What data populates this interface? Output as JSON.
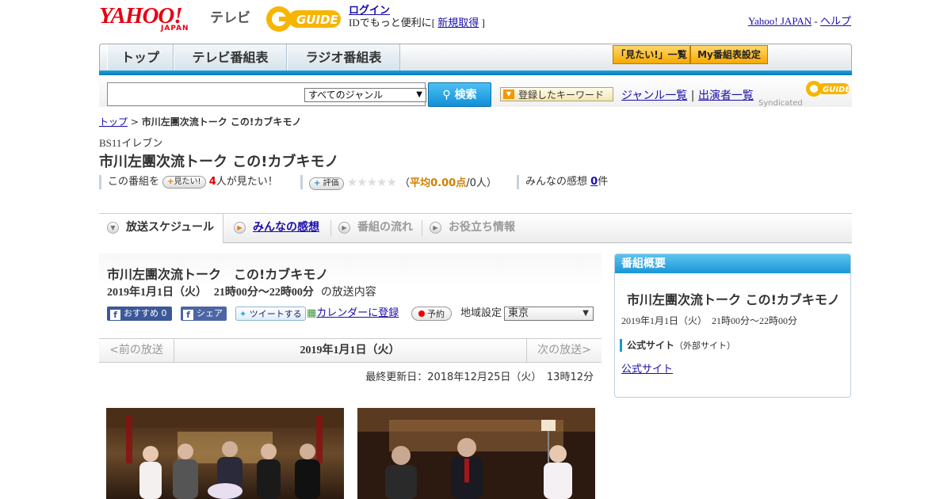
{
  "header": {
    "yahoo_logo": "YAHOO!",
    "yahoo_sub": "JAPAN",
    "tv_label": "テレビ",
    "gguide_logo": "G GUIDE",
    "login": "ログイン",
    "login_msg": "IDでもっと便利に[",
    "register": "新規取得",
    "login_msg_end": "]",
    "yahoo_japan_link": "Yahoo! JAPAN",
    "dash": "-",
    "help_link": "ヘルプ"
  },
  "nav": {
    "tabs": [
      "トップ",
      "テレビ番組表",
      "ラジオ番組表"
    ],
    "mitai_btn": "「見たい!」一覧",
    "my_btn": "My番組表設定"
  },
  "search": {
    "placeholder": "",
    "genre": "すべてのジャンル",
    "button": "検索",
    "keyword_btn": "登録したキーワード",
    "genre_list": "ジャンル一覧",
    "sep": "|",
    "performers": "出演者一覧",
    "syndicated": "Syndicated"
  },
  "breadcrumb": {
    "top": "トップ",
    "sep": ">",
    "current": "市川左團次流トーク この!カブキモノ"
  },
  "program": {
    "channel": "BS11イレブン",
    "title": "市川左團次流トーク この!カブキモノ",
    "watch_prefix": "この番組を",
    "mitai_pill": "見たい!",
    "watch_count": "4",
    "watch_suffix": "人が見たい！",
    "rate_pill": "評価",
    "stars": "★★★★★",
    "avg_open": "（",
    "avg": "平均0.00点",
    "avg_rest": "/0人）",
    "comments_label": "みんなの感想",
    "comments_count": "0",
    "comments_suffix": "件"
  },
  "tabs": [
    {
      "label": "放送スケジュール"
    },
    {
      "label": "みんなの感想"
    },
    {
      "label": "番組の流れ"
    },
    {
      "label": "お役立ち情報"
    }
  ],
  "broadcast": {
    "title": "市川左團次流トーク　この!カブキモノ",
    "date": "2019年1月1日（火）",
    "time": "21時00分～22時00分",
    "suffix": "の放送内容",
    "recommend": "おすすめ",
    "recommend_count": "0",
    "share": "シェア",
    "tweet": "ツイートする",
    "calendar": "カレンダーに登録",
    "reserve": "予約",
    "region_label": "地域設定",
    "region": "東京",
    "prev": "<前の放送",
    "current_date": "2019年1月1日（火）",
    "next": "次の放送>",
    "updated": "最終更新日：2018年12月25日（火）　13時12分"
  },
  "sidebar": {
    "header": "番組概要",
    "title": "市川左團次流トーク この!カブキモノ",
    "datetime": "2019年1月1日（火）　21時00分～22時00分",
    "official_label": "公式サイト",
    "official_note": "（外部サイト）",
    "official_link": "公式サイト"
  },
  "colors": {
    "accent_blue": "#1a95d6",
    "brand_red": "#e60012",
    "gguide_yellow": "#f7b500"
  }
}
